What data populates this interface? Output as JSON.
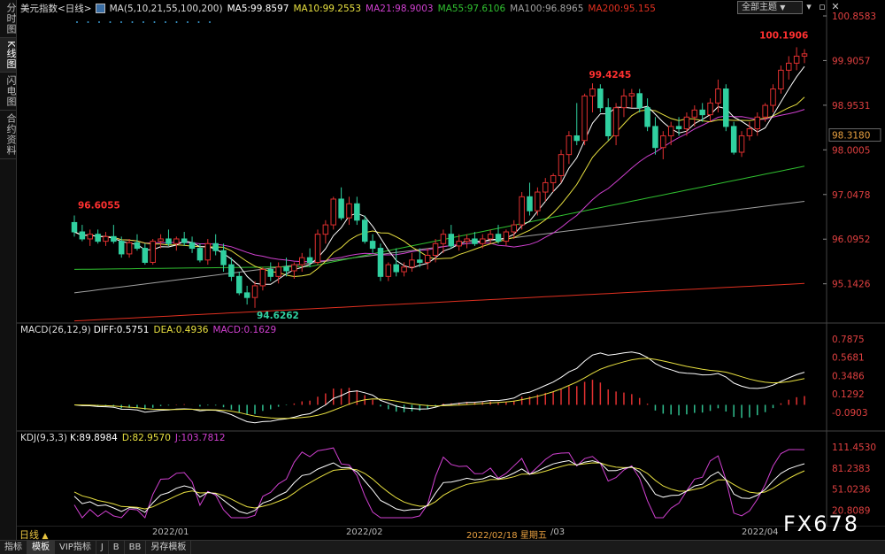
{
  "sidebar": {
    "tabs": [
      "分时图",
      "K线图",
      "闪电图",
      "合约资料"
    ],
    "active": 1
  },
  "main_legend": {
    "title": "美元指数<日线>",
    "ma_params": "MA(5,10,21,55,100,200)",
    "ma5": "MA5:99.8597",
    "ma10": "MA10:99.2553",
    "ma21": "MA21:98.9003",
    "ma55": "MA55:97.6106",
    "ma100": "MA100:96.8965",
    "ma200": "MA200:95.155",
    "colors": {
      "ma5": "#ffffff",
      "ma10": "#e8e040",
      "ma21": "#d040d0",
      "ma55": "#30c030",
      "ma100": "#a0a0a0",
      "ma200": "#e03020"
    }
  },
  "toolbar": {
    "theme_label": "全部主题",
    "theme_arrow": "▼",
    "btn_down": "▾",
    "btn_max": "▫",
    "btn_close": "✕"
  },
  "price_axis": [
    "100.8583",
    "99.9057",
    "98.9531",
    "98.0005",
    "97.0478",
    "96.0952",
    "95.1426"
  ],
  "current_price": "98.3180",
  "annotations": {
    "high1": "100.1906",
    "high2": "99.4245",
    "high_left": "96.6055",
    "low": "94.6262"
  },
  "macd_legend": {
    "label": "MACD(26,12,9)",
    "diff": "DIFF:0.5751",
    "dea": "DEA:0.4936",
    "macd": "MACD:0.1629"
  },
  "macd_axis": [
    "0.7875",
    "0.5681",
    "0.3486",
    "0.1292",
    "-0.0903"
  ],
  "kdj_legend": {
    "label": "KDJ(9,3,3)",
    "k": "K:89.8984",
    "d": "D:82.9570",
    "j": "J:103.7812"
  },
  "kdj_axis": [
    "111.4530",
    "81.2383",
    "51.0236",
    "20.8089"
  ],
  "x_axis": {
    "period": "日线",
    "period_arrow": "▲",
    "jan": "2022/01",
    "feb": "2022/02",
    "cursor": "2022/02/18 星期五",
    "mar": "/03",
    "apr": "2022/04"
  },
  "bottom_tabs": [
    "指标",
    "模板",
    "VIP指标",
    "J",
    "B",
    "BB",
    "另存模板"
  ],
  "bottom_active": 1,
  "watermark": "FX678",
  "chart_data": {
    "type": "candlestick",
    "candles": [
      [
        96.45,
        96.6,
        96.15,
        96.25
      ],
      [
        96.25,
        96.4,
        96.05,
        96.1
      ],
      [
        96.1,
        96.3,
        95.95,
        96.2
      ],
      [
        96.2,
        96.3,
        96.0,
        96.05
      ],
      [
        96.05,
        96.25,
        95.95,
        96.15
      ],
      [
        96.15,
        96.4,
        96.0,
        96.05
      ],
      [
        96.05,
        96.15,
        95.7,
        95.78
      ],
      [
        95.78,
        96.1,
        95.7,
        96.02
      ],
      [
        96.02,
        96.2,
        95.85,
        95.9
      ],
      [
        95.9,
        96.0,
        95.55,
        95.6
      ],
      [
        95.6,
        96.1,
        95.55,
        96.05
      ],
      [
        96.05,
        96.2,
        95.9,
        96.1
      ],
      [
        96.1,
        96.3,
        95.95,
        96.0
      ],
      [
        96.0,
        96.15,
        95.85,
        96.1
      ],
      [
        96.1,
        96.25,
        95.95,
        96.02
      ],
      [
        96.02,
        96.15,
        95.8,
        95.9
      ],
      [
        95.9,
        96.0,
        95.6,
        95.65
      ],
      [
        95.65,
        96.1,
        95.55,
        96.0
      ],
      [
        96.0,
        96.2,
        95.75,
        95.85
      ],
      [
        95.85,
        96.0,
        95.4,
        95.55
      ],
      [
        95.55,
        95.7,
        95.2,
        95.3
      ],
      [
        95.3,
        95.4,
        94.9,
        94.95
      ],
      [
        94.95,
        95.1,
        94.7,
        94.85
      ],
      [
        94.85,
        95.2,
        94.63,
        95.1
      ],
      [
        95.1,
        95.5,
        95.0,
        95.45
      ],
      [
        95.45,
        95.6,
        95.2,
        95.3
      ],
      [
        95.3,
        95.6,
        95.15,
        95.5
      ],
      [
        95.5,
        95.7,
        95.3,
        95.42
      ],
      [
        95.42,
        95.6,
        95.25,
        95.55
      ],
      [
        95.55,
        95.8,
        95.4,
        95.7
      ],
      [
        95.7,
        95.9,
        95.5,
        95.6
      ],
      [
        95.6,
        96.3,
        95.55,
        96.2
      ],
      [
        96.2,
        96.5,
        96.0,
        96.4
      ],
      [
        96.4,
        97.0,
        96.3,
        96.95
      ],
      [
        96.95,
        97.2,
        96.5,
        96.55
      ],
      [
        96.55,
        97.0,
        96.4,
        96.85
      ],
      [
        96.85,
        97.0,
        96.4,
        96.5
      ],
      [
        96.5,
        96.6,
        96.0,
        96.05
      ],
      [
        96.05,
        96.2,
        95.8,
        95.9
      ],
      [
        95.9,
        96.0,
        95.2,
        95.3
      ],
      [
        95.3,
        95.6,
        95.2,
        95.55
      ],
      [
        95.55,
        95.9,
        95.3,
        95.4
      ],
      [
        95.4,
        95.6,
        95.3,
        95.5
      ],
      [
        95.5,
        95.8,
        95.4,
        95.65
      ],
      [
        95.65,
        95.9,
        95.5,
        95.6
      ],
      [
        95.6,
        95.9,
        95.45,
        95.75
      ],
      [
        95.75,
        96.1,
        95.6,
        96.0
      ],
      [
        96.0,
        96.3,
        95.8,
        96.2
      ],
      [
        96.2,
        96.4,
        95.9,
        95.95
      ],
      [
        95.95,
        96.2,
        95.85,
        96.05
      ],
      [
        96.05,
        96.2,
        95.9,
        96.1
      ],
      [
        96.1,
        96.25,
        95.95,
        96.0
      ],
      [
        96.0,
        96.2,
        95.9,
        96.1
      ],
      [
        96.1,
        96.3,
        96.0,
        96.2
      ],
      [
        96.2,
        96.4,
        96.0,
        96.05
      ],
      [
        96.05,
        96.3,
        95.95,
        96.25
      ],
      [
        96.25,
        96.5,
        96.1,
        96.4
      ],
      [
        96.4,
        97.1,
        96.3,
        97.0
      ],
      [
        97.0,
        97.3,
        96.6,
        96.7
      ],
      [
        96.7,
        97.2,
        96.6,
        97.1
      ],
      [
        97.1,
        97.4,
        96.9,
        97.3
      ],
      [
        97.3,
        97.5,
        97.1,
        97.45
      ],
      [
        97.45,
        98.0,
        97.3,
        97.9
      ],
      [
        97.9,
        98.4,
        97.7,
        98.3
      ],
      [
        98.3,
        99.0,
        98.1,
        98.2
      ],
      [
        98.2,
        99.2,
        98.1,
        99.15
      ],
      [
        99.15,
        99.42,
        98.8,
        99.3
      ],
      [
        99.3,
        99.4,
        98.8,
        98.9
      ],
      [
        98.9,
        99.1,
        98.2,
        98.3
      ],
      [
        98.3,
        99.0,
        98.1,
        98.9
      ],
      [
        98.9,
        99.3,
        98.7,
        99.15
      ],
      [
        99.15,
        99.3,
        98.9,
        99.2
      ],
      [
        99.2,
        99.3,
        98.8,
        98.9
      ],
      [
        98.9,
        99.1,
        98.4,
        98.5
      ],
      [
        98.5,
        98.7,
        97.9,
        98.05
      ],
      [
        98.05,
        98.4,
        97.8,
        98.3
      ],
      [
        98.3,
        98.6,
        98.1,
        98.5
      ],
      [
        98.5,
        98.7,
        98.3,
        98.45
      ],
      [
        98.45,
        98.8,
        98.3,
        98.7
      ],
      [
        98.7,
        98.95,
        98.5,
        98.85
      ],
      [
        98.85,
        99.0,
        98.6,
        98.75
      ],
      [
        98.75,
        99.1,
        98.6,
        99.0
      ],
      [
        99.0,
        99.5,
        98.8,
        99.3
      ],
      [
        99.3,
        99.4,
        98.4,
        98.5
      ],
      [
        98.5,
        98.6,
        97.9,
        97.95
      ],
      [
        97.95,
        98.4,
        97.85,
        98.3
      ],
      [
        98.3,
        98.6,
        98.2,
        98.45
      ],
      [
        98.45,
        98.8,
        98.3,
        98.7
      ],
      [
        98.7,
        99.0,
        98.6,
        98.95
      ],
      [
        98.95,
        99.4,
        98.8,
        99.3
      ],
      [
        99.3,
        99.8,
        99.2,
        99.7
      ],
      [
        99.7,
        100.0,
        99.5,
        99.85
      ],
      [
        99.85,
        100.19,
        99.7,
        100.0
      ],
      [
        100.0,
        100.15,
        99.85,
        100.05
      ]
    ]
  }
}
